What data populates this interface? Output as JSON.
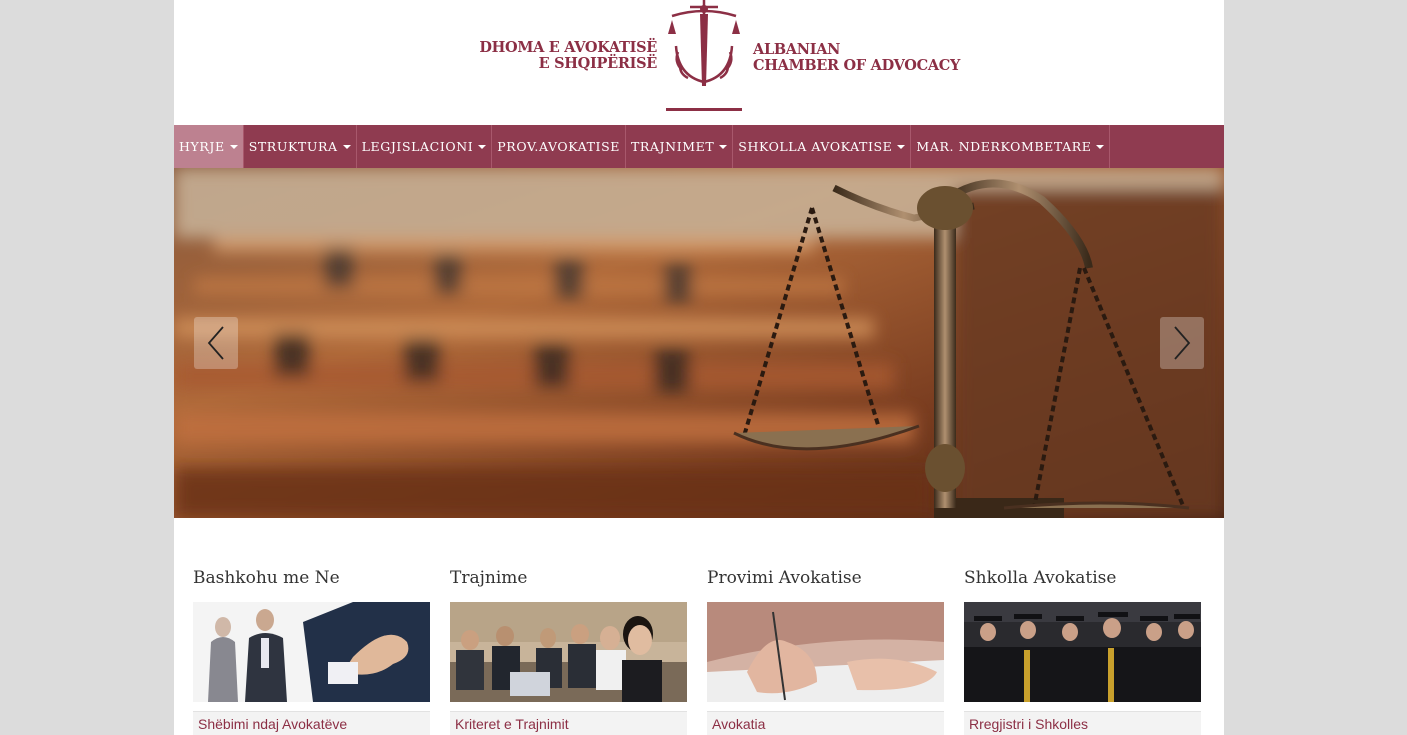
{
  "logo": {
    "left_line1": "DHOMA E AVOKATISË",
    "left_line2": "E SHQIPËRISË",
    "right_line1": "ALBANIAN",
    "right_line2": "CHAMBER OF ADVOCACY"
  },
  "colors": {
    "brand": "#8c2f45",
    "nav_bg": "#8f3b50",
    "nav_active": "#bd8190",
    "page_bg": "#dcdcdc"
  },
  "nav": {
    "items": [
      {
        "label": "HYRJE",
        "dropdown": true,
        "active": true
      },
      {
        "label": "STRUKTURA",
        "dropdown": true
      },
      {
        "label": "LEGJISLACIONI",
        "dropdown": true
      },
      {
        "label": "PROV.AVOKATISE",
        "dropdown": false
      },
      {
        "label": "TRAJNIMET",
        "dropdown": true
      },
      {
        "label": "SHKOLLA AVOKATISE",
        "dropdown": true
      },
      {
        "label": "MAR. NDERKOMBETARE",
        "dropdown": true
      }
    ]
  },
  "hero": {
    "prev_icon": "chevron-left-icon",
    "next_icon": "chevron-right-icon"
  },
  "cards": [
    {
      "title": "Bashkohu me Ne",
      "link": "Shëbimi ndaj Avokatëve",
      "image": "handshake-photo"
    },
    {
      "title": "Trajnime",
      "link": "Kriteret e Trajnimit",
      "image": "training-group-photo"
    },
    {
      "title": "Provimi Avokatise",
      "link": "Avokatia",
      "image": "writing-hand-photo"
    },
    {
      "title": "Shkolla Avokatise",
      "link": "Rregjistri i Shkolles",
      "image": "graduation-photo"
    }
  ]
}
